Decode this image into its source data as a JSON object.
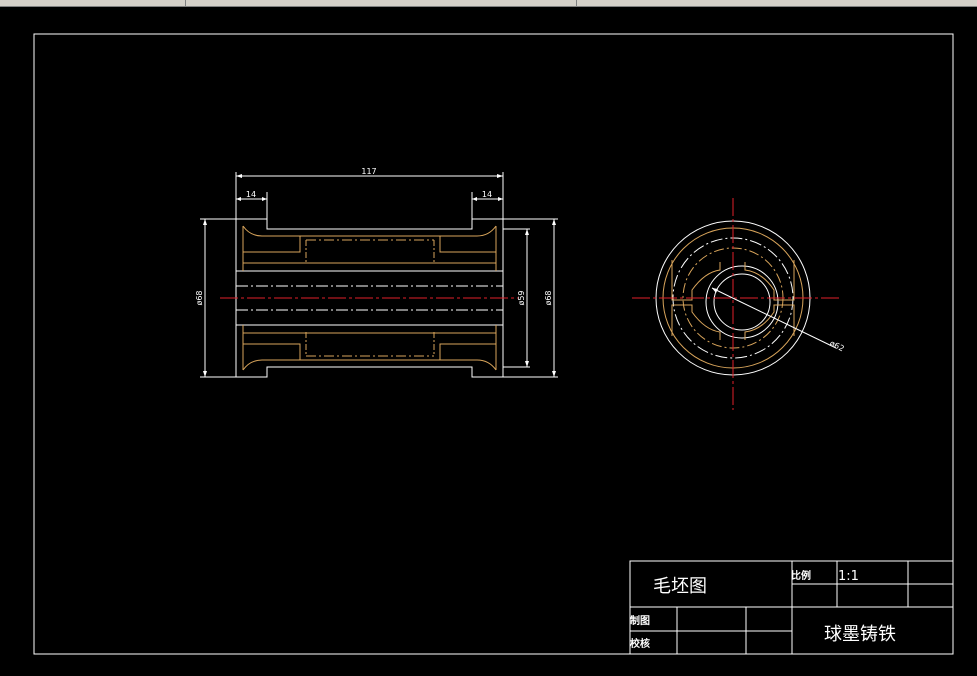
{
  "colors": {
    "background": "#000000",
    "outline": "#ffffff",
    "hidden_line": "#d9a55b",
    "center_line": "#e0202a",
    "window_bar": "#d4d0c8"
  },
  "dimensions": {
    "overall_length": "117",
    "left_flange": "14",
    "right_flange": "14",
    "left_diameter": "ø68",
    "inner_diameter": "ø59",
    "right_diameter": "ø68",
    "radius_label": "ø62"
  },
  "title_block": {
    "title": "毛坯图",
    "scale_label": "比例",
    "scale_value": "1:1",
    "drawn_label": "制图",
    "checked_label": "校核",
    "material": "球墨铸铁"
  }
}
